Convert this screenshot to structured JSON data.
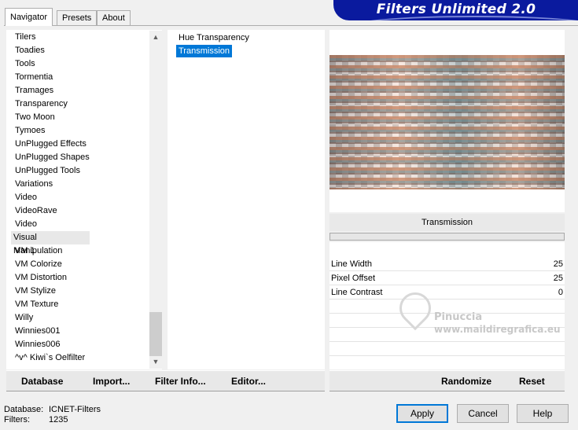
{
  "tabs": [
    {
      "label": "Navigator",
      "active": true
    },
    {
      "label": "Presets",
      "active": false
    },
    {
      "label": "About",
      "active": false
    }
  ],
  "banner_title": "Filters Unlimited 2.0",
  "categories": [
    "Tilers",
    "Toadies",
    "Tools",
    "Tormentia",
    "Tramages",
    "Transparency",
    "Two Moon",
    "Tymoes",
    "UnPlugged Effects",
    "UnPlugged Shapes",
    "UnPlugged Tools",
    "Variations",
    "Video",
    "VideoRave",
    "Video",
    "Visual Manipulation",
    "VM 1",
    "VM Colorize",
    "VM Distortion",
    "VM Stylize",
    "VM Texture",
    "Willy",
    "Winnies001",
    "Winnies006",
    "^v^ Kiwi`s Oelfilter"
  ],
  "selected_category": "Visual Manipulation",
  "filters": [
    "Hue Transparency",
    "Transmission"
  ],
  "selected_filter": "Transmission",
  "filter_title": "Transmission",
  "params": [
    {
      "label": "Line Width",
      "value": "25"
    },
    {
      "label": "Pixel Offset",
      "value": "25"
    },
    {
      "label": "Line Contrast",
      "value": "0"
    }
  ],
  "watermark": {
    "line1": "Pinuccia",
    "line2": "www.maildiregrafica.eu"
  },
  "toolbar": {
    "database": "Database",
    "import": "Import...",
    "filter_info": "Filter Info...",
    "editor": "Editor...",
    "randomize": "Randomize",
    "reset": "Reset"
  },
  "status": {
    "database_label": "Database:",
    "database_value": "ICNET-Filters",
    "filters_label": "Filters:",
    "filters_value": "1235"
  },
  "buttons": {
    "apply": "Apply",
    "cancel": "Cancel",
    "help": "Help"
  },
  "icons": {
    "scroll_up": "scroll-up-icon",
    "scroll_down": "scroll-down-icon"
  }
}
